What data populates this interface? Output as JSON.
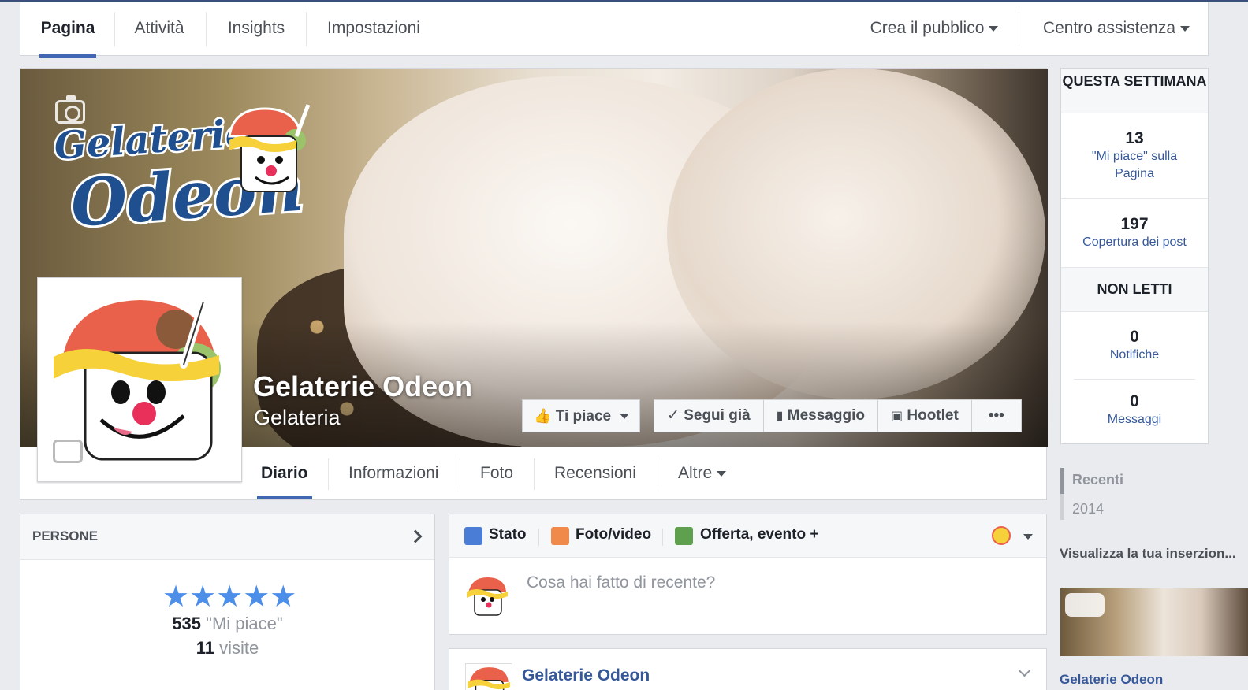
{
  "admin_tabs": {
    "items": [
      "Pagina",
      "Attività",
      "Insights",
      "Impostazioni"
    ],
    "right": [
      "Crea il pubblico",
      "Centro assistenza"
    ]
  },
  "cover": {
    "page_name": "Gelaterie Odeon",
    "category": "Gelateria",
    "logo_line1": "Gelaterie",
    "logo_line2": "Odeon"
  },
  "actions": {
    "like": "Ti piace",
    "follow": "Segui già",
    "message": "Messaggio",
    "hootlet": "Hootlet",
    "more": "•••"
  },
  "page_tabs": [
    "Diario",
    "Informazioni",
    "Foto",
    "Recensioni",
    "Altre"
  ],
  "stats": {
    "week_header": "QUESTA SETTIMANA",
    "likes_num": "13",
    "likes_label": "\"Mi piace\" sulla Pagina",
    "reach_num": "197",
    "reach_label": "Copertura dei post",
    "unread_header": "NON LETTI",
    "notif_num": "0",
    "notif_label": "Notifiche",
    "msg_num": "0",
    "msg_label": "Messaggi"
  },
  "timeline_nav": [
    "Recenti",
    "2014"
  ],
  "ad": {
    "title": "Visualizza la tua inserzion...",
    "name": "Gelaterie Odeon"
  },
  "persone": {
    "title": "PERSONE",
    "stars": "★★★★★",
    "rating_value": 5,
    "likes_num": "535",
    "likes_label": "\"Mi piace\"",
    "visits_num": "11",
    "visits_label": "visite"
  },
  "composer": {
    "tabs": [
      "Stato",
      "Foto/video",
      "Offerta, evento +"
    ],
    "placeholder": "Cosa hai fatto di recente?"
  },
  "post": {
    "author": "Gelaterie Odeon"
  },
  "colors": {
    "fb_blue": "#4267b2",
    "link_blue": "#365899",
    "star_blue": "#4d8fe8"
  }
}
